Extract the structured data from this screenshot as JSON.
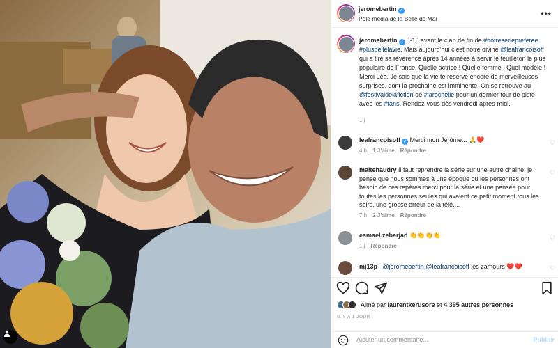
{
  "post": {
    "author": "jeromebertin",
    "location": "Pôle média de la Belle de Mai"
  },
  "caption": {
    "author": "jeromebertin",
    "text_1": "J-15 avant le clap de fin de",
    "tag_1": "#notreseriepreferee",
    "tag_2": "#plusbellelavie",
    "text_2": ". Mais aujourd’hui c’est notre divine",
    "mention_1": "@leafrancoisoff",
    "text_3": "qui a tiré sa révérence après 14 années à servir le feuilleton le plus populaire de France. Quelle actrice ! Quelle femme ! Quel modèle ! Merci Léa. Je sais que la vie te réserve encore de merveilleuses surprises, dont la prochaine est imminente. On se retrouve au",
    "mention_2": "@festivaldelafiction",
    "text_4": "de",
    "tag_3": "#larochelle",
    "text_5": "pour un dernier tour de piste avec les",
    "tag_4": "#fans",
    "text_6": ". Rendez-vous dès vendredi après-midi.",
    "age": "1 j"
  },
  "comments": [
    {
      "user": "leafrancoisoff",
      "verified": true,
      "text": "Merci mon Jérôme... 🙏❤️",
      "age": "4 h",
      "likes": "1 J’aime",
      "reply": "Répondre"
    },
    {
      "user": "maitehaudry",
      "text": "Il faut reprendre la série sur une autre chaîne, je pense que nous sommes à une époque où les personnes ont besoin de ces repères merci pour la série et une pensée pour toutes les personnes seules qui avaient ce petit moment tous les soirs, une grosse erreur de la télé....",
      "age": "7 h",
      "likes": "2 J’aime",
      "reply": "Répondre"
    },
    {
      "user": "esmael.zebarjad",
      "text": "👏👏👏👏",
      "age": "1 j",
      "reply": "Répondre"
    },
    {
      "user": "mj13p_",
      "mention_1": "@jeromebertin",
      "mention_2": "@leafrancoisoff",
      "text": "les zamours ❤️❤️"
    }
  ],
  "likes": {
    "prefix": "Aimé par",
    "user": "laurentkerusore",
    "middle": "et",
    "others": "4,395 autres personnes"
  },
  "date": "IL Y A 1 JOUR",
  "add_comment": {
    "placeholder": "Ajouter un commentaire...",
    "post_label": "Publier"
  },
  "icons": {
    "like": "heart-icon",
    "comment": "comment-icon",
    "share": "paper-plane-icon",
    "save": "bookmark-icon",
    "emoji": "smiley-icon",
    "more": "more-options-icon",
    "tagged": "user-tag-icon"
  },
  "colors": {
    "link": "#00376b",
    "verified": "#3897f0",
    "muted": "#8e8e8e",
    "post_disabled": "#b2dffc"
  }
}
